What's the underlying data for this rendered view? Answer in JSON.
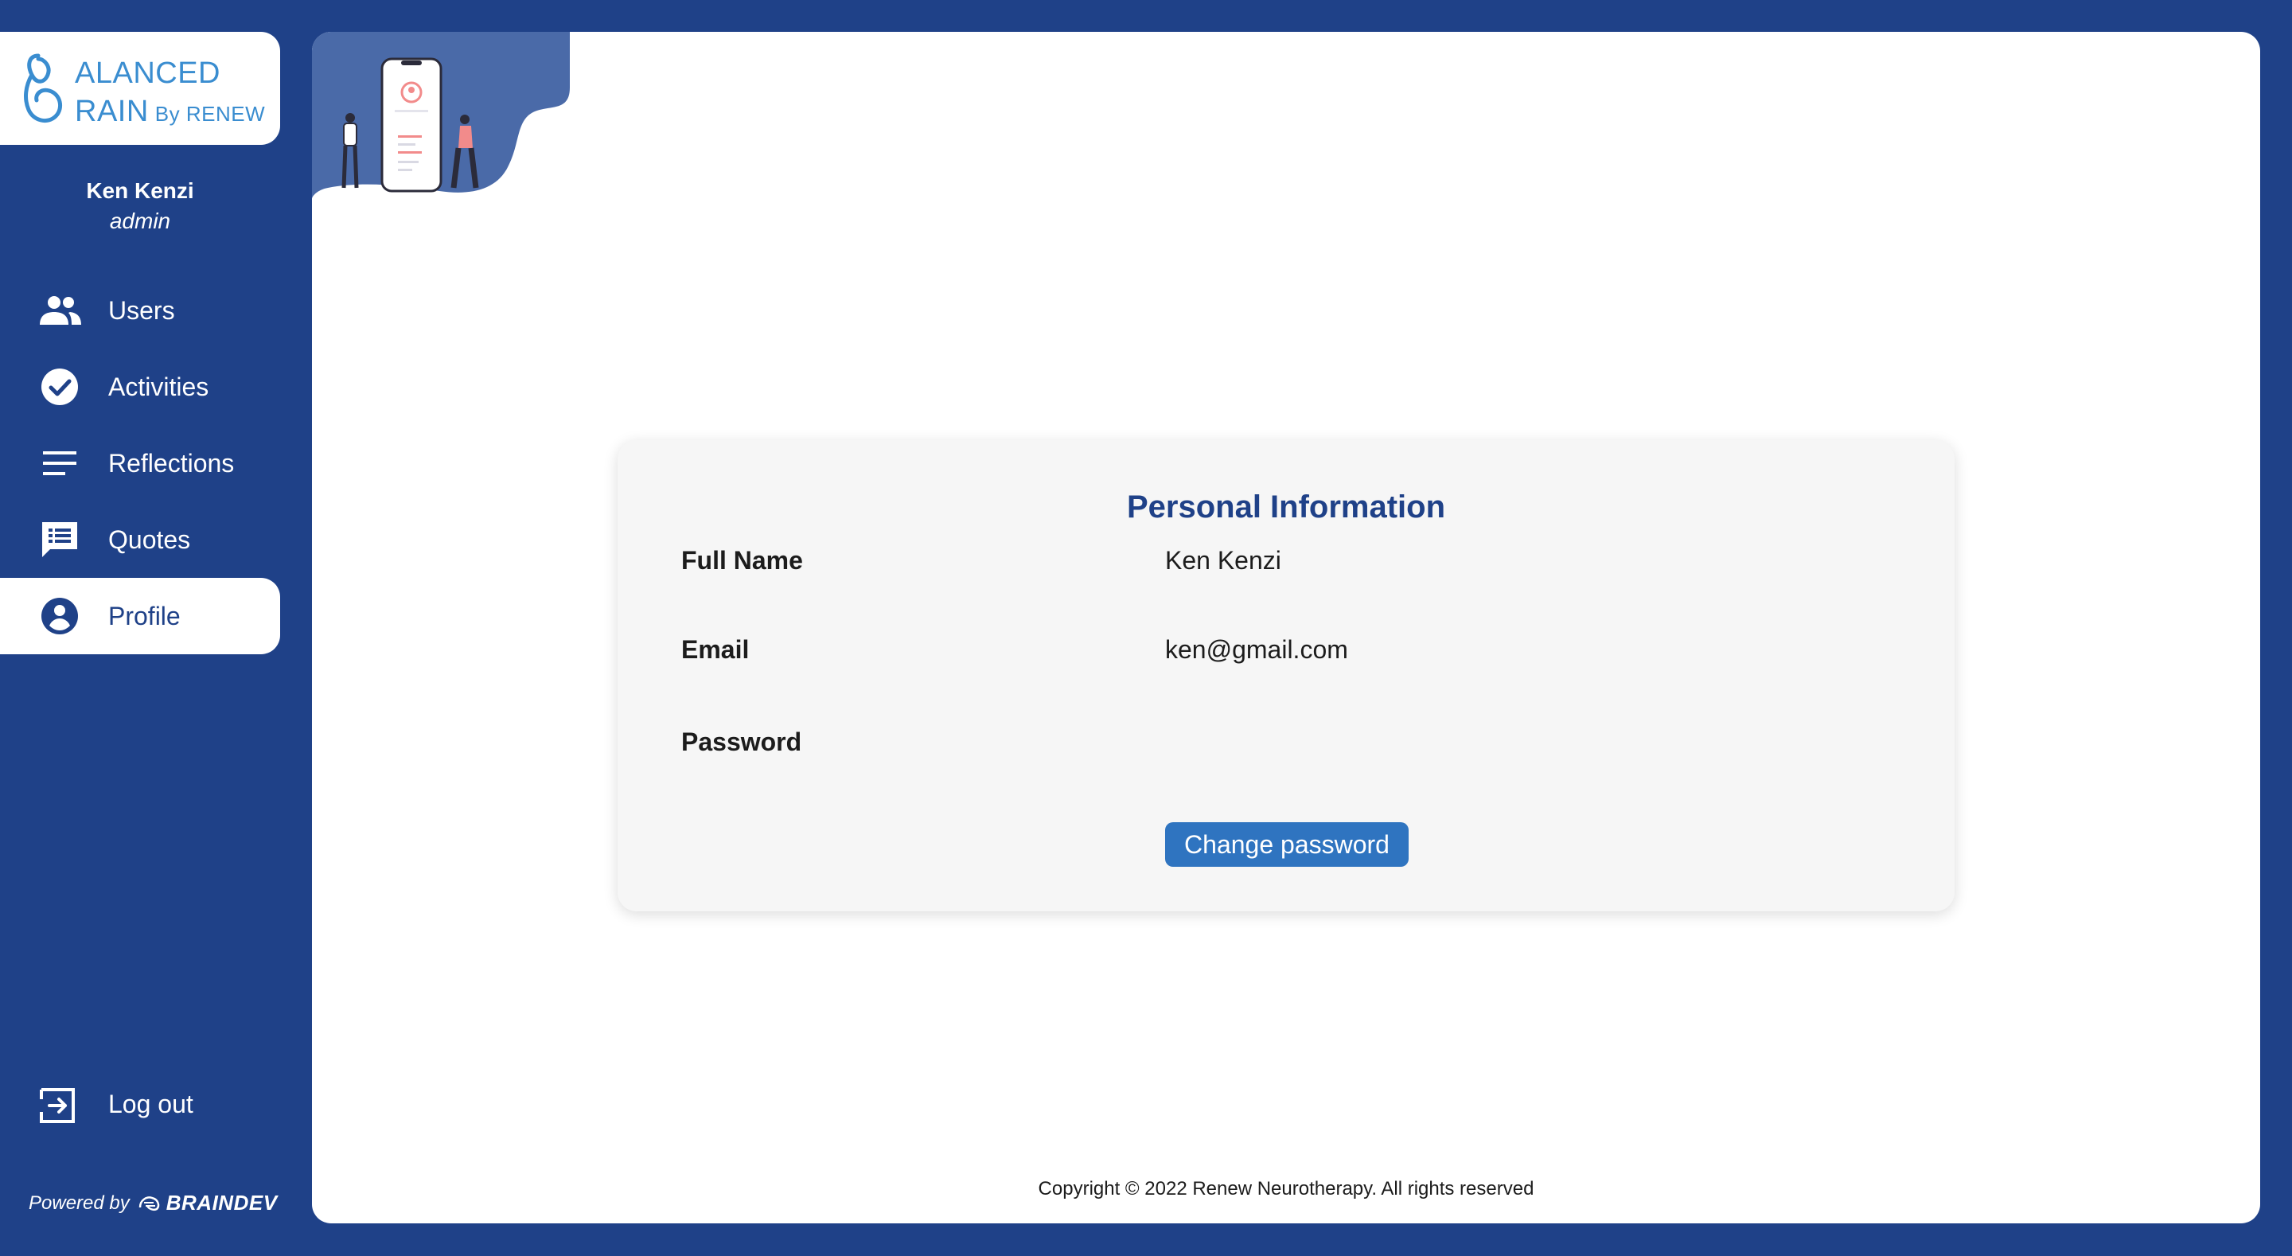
{
  "brand": {
    "line1": "ALANCED",
    "line2": "RAIN",
    "by": "By RENEW"
  },
  "user": {
    "name": "Ken Kenzi",
    "role": "admin"
  },
  "nav": {
    "items": [
      {
        "label": "Users",
        "icon": "users-icon"
      },
      {
        "label": "Activities",
        "icon": "check-circle-icon"
      },
      {
        "label": "Reflections",
        "icon": "lines-icon"
      },
      {
        "label": "Quotes",
        "icon": "quote-chat-icon"
      },
      {
        "label": "Profile",
        "icon": "account-circle-icon",
        "active": true
      }
    ],
    "logout": "Log out"
  },
  "powered": {
    "prefix": "Powered by",
    "brand": "BRAINDEV"
  },
  "profile": {
    "title": "Personal Information",
    "fields": [
      {
        "label": "Full Name",
        "value": "Ken Kenzi"
      },
      {
        "label": "Email",
        "value": "ken@gmail.com"
      },
      {
        "label": "Password"
      }
    ],
    "change_password_label": "Change password"
  },
  "footer": {
    "copyright": "Copyright © 2022 Renew Neurotherapy. All rights reserved"
  },
  "colors": {
    "primary": "#1f4188",
    "button": "#2f74c0",
    "logo": "#3a8dd0",
    "card": "#f6f6f6"
  }
}
